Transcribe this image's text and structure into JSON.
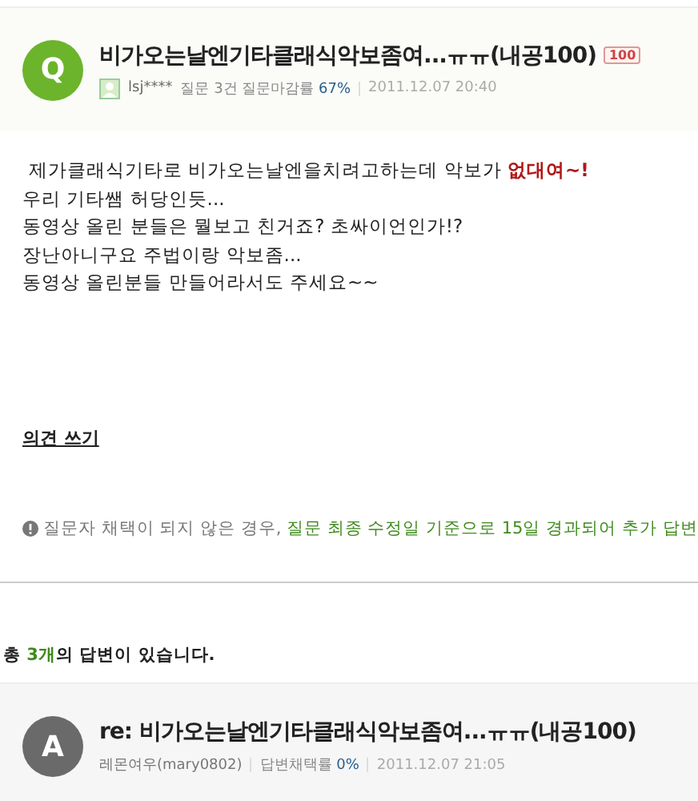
{
  "question": {
    "badge": "Q",
    "title": "비가오는날엔기타클래식악보좀여...ㅠㅠ(내공100)",
    "points": "100",
    "author": "lsj****",
    "stats_label": "질문 3건 질문마감률",
    "stats_value": "67%",
    "date": "2011.12.07 20:40"
  },
  "body": {
    "lines": [
      "제가클래식기타로 비가오는날엔을치려고하는데 악보가 **없대여~!**",
      "우리 기타쌤 허당인듯...",
      "동영상 올린 분들은 뭘보고 친거죠? 초싸이언인가!?",
      "장난아니구요 주법이랑 악보좀...",
      "동영상 올린분들 만들어라서도 주세요~~"
    ]
  },
  "comment_link": "의견 쓰기",
  "notice": {
    "plain": "질문자 채택이 되지 않은 경우,",
    "highlight": "질문 최종 수정일 기준으로 15일 경과되어 추가 답변"
  },
  "answer_count": {
    "prefix": "총",
    "count": "3개",
    "suffix": "의 답변이 있습니다."
  },
  "answer": {
    "badge": "A",
    "title": "re: 비가오는날엔기타클래식악보좀여...ㅠㅠ(내공100)",
    "author": "레몬여우(mary0802)",
    "stats_label": "답변채택률",
    "stats_value": "0%",
    "date": "2011.12.07 21:05"
  }
}
